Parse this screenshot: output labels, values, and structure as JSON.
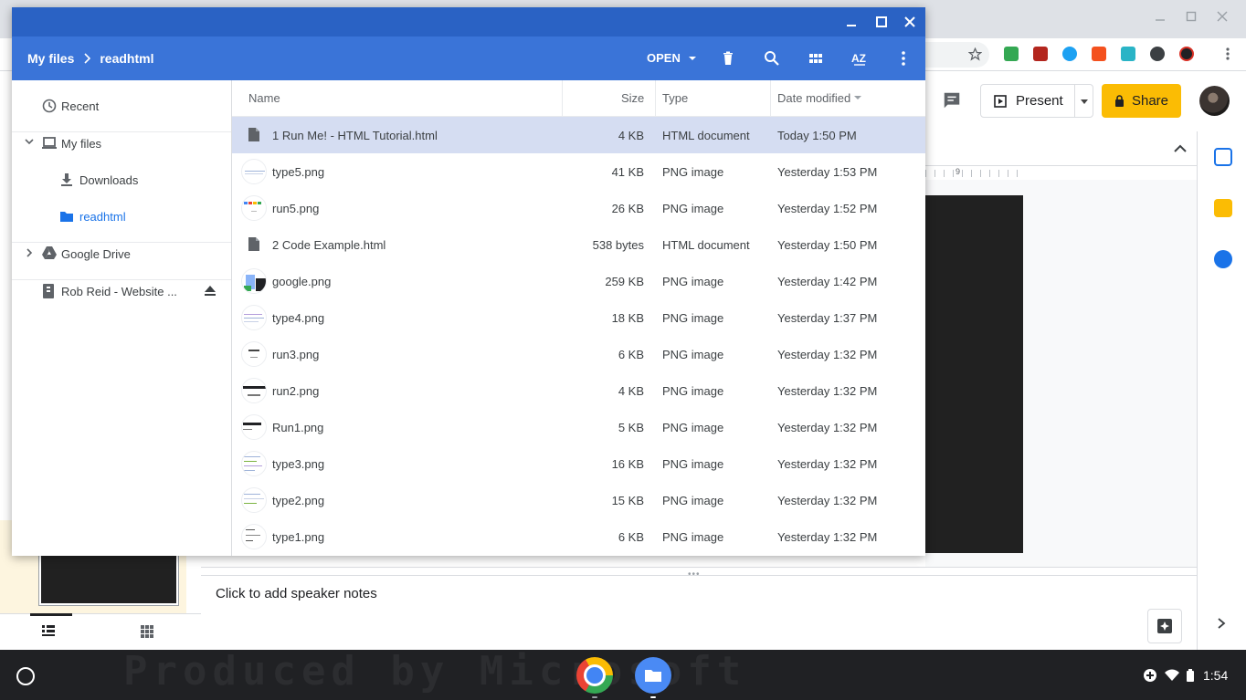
{
  "dialog": {
    "breadcrumb": [
      "My files",
      "readhtml"
    ],
    "open_label": "OPEN",
    "icons": [
      "delete-icon",
      "search-icon",
      "grid-view-icon",
      "sort-az-icon",
      "more-vert-icon"
    ]
  },
  "nav": {
    "items": [
      {
        "label": "Recent",
        "icon": "clock-icon"
      },
      {
        "label": "My files",
        "icon": "laptop-icon"
      },
      {
        "label": "Downloads",
        "icon": "download-icon"
      },
      {
        "label": "readhtml",
        "icon": "folder-icon"
      },
      {
        "label": "Google Drive",
        "icon": "drive-icon"
      },
      {
        "label": "Rob Reid - Website ...",
        "icon": "usb-icon"
      }
    ]
  },
  "columns": {
    "name": "Name",
    "size": "Size",
    "type": "Type",
    "date": "Date modified"
  },
  "files": [
    {
      "name": "1 Run Me! - HTML Tutorial.html",
      "size": "4 KB",
      "type": "HTML document",
      "date": "Today 1:50 PM"
    },
    {
      "name": "type5.png",
      "size": "41 KB",
      "type": "PNG image",
      "date": "Yesterday 1:53 PM"
    },
    {
      "name": "run5.png",
      "size": "26 KB",
      "type": "PNG image",
      "date": "Yesterday 1:52 PM"
    },
    {
      "name": "2 Code Example.html",
      "size": "538 bytes",
      "type": "HTML document",
      "date": "Yesterday 1:50 PM"
    },
    {
      "name": "google.png",
      "size": "259 KB",
      "type": "PNG image",
      "date": "Yesterday 1:42 PM"
    },
    {
      "name": "type4.png",
      "size": "18 KB",
      "type": "PNG image",
      "date": "Yesterday 1:37 PM"
    },
    {
      "name": "run3.png",
      "size": "6 KB",
      "type": "PNG image",
      "date": "Yesterday 1:32 PM"
    },
    {
      "name": "run2.png",
      "size": "4 KB",
      "type": "PNG image",
      "date": "Yesterday 1:32 PM"
    },
    {
      "name": "Run1.png",
      "size": "5 KB",
      "type": "PNG image",
      "date": "Yesterday 1:32 PM"
    },
    {
      "name": "type3.png",
      "size": "16 KB",
      "type": "PNG image",
      "date": "Yesterday 1:32 PM"
    },
    {
      "name": "type2.png",
      "size": "15 KB",
      "type": "PNG image",
      "date": "Yesterday 1:32 PM"
    },
    {
      "name": "type1.png",
      "size": "6 KB",
      "type": "PNG image",
      "date": "Yesterday 1:32 PM"
    }
  ],
  "slides": {
    "present_label": "Present",
    "share_label": "Share",
    "speaker_notes": "Click to add speaker notes",
    "ruler_mark": "9"
  },
  "shelf": {
    "clock": "1:54",
    "watermark": "Produced by Microsoft"
  },
  "colors": {
    "dialog_header": "#3a74d8",
    "titlebar": "#2a62c4",
    "selected_row": "#d5ddf2",
    "share": "#fbbc04"
  }
}
